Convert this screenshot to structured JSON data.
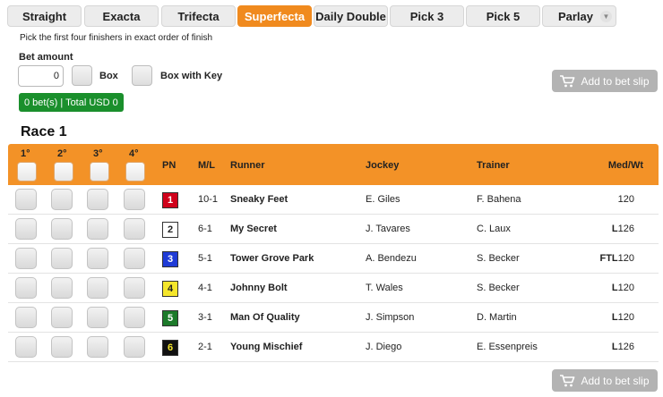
{
  "tabs": [
    {
      "label": "Straight",
      "active": false
    },
    {
      "label": "Exacta",
      "active": false
    },
    {
      "label": "Trifecta",
      "active": false
    },
    {
      "label": "Superfecta",
      "active": true
    },
    {
      "label": "Daily Double",
      "active": false
    },
    {
      "label": "Pick 3",
      "active": false
    },
    {
      "label": "Pick 5",
      "active": false
    },
    {
      "label": "Parlay",
      "active": false
    }
  ],
  "description": "Pick the first four finishers in exact order of finish",
  "bet": {
    "label": "Bet amount",
    "value": "0",
    "box_label": "Box",
    "box_with_key_label": "Box with Key"
  },
  "add_to_slip_label": "Add to bet slip",
  "total_badge": "0 bet(s) | Total USD 0",
  "race": {
    "title": "Race 1",
    "columns": {
      "pos1": "1°",
      "pos2": "2°",
      "pos3": "3°",
      "pos4": "4°",
      "pn": "PN",
      "ml": "M/L",
      "runner": "Runner",
      "jockey": "Jockey",
      "trainer": "Trainer",
      "medwt": "Med/Wt"
    },
    "entries": [
      {
        "pn": "1",
        "ml": "10-1",
        "runner": "Sneaky Feet",
        "jockey": "E. Giles",
        "trainer": "F. Bahena",
        "med": "",
        "wt": "120",
        "pn_bg": "#d0021b",
        "pn_fg": "#ffffff"
      },
      {
        "pn": "2",
        "ml": "6-1",
        "runner": "My Secret",
        "jockey": "J. Tavares",
        "trainer": "C. Laux",
        "med": "L",
        "wt": "126",
        "pn_bg": "#ffffff",
        "pn_fg": "#222222"
      },
      {
        "pn": "3",
        "ml": "5-1",
        "runner": "Tower Grove Park",
        "jockey": "A. Bendezu",
        "trainer": "S. Becker",
        "med": "FTL",
        "wt": "120",
        "pn_bg": "#1f3bd6",
        "pn_fg": "#ffffff"
      },
      {
        "pn": "4",
        "ml": "4-1",
        "runner": "Johnny Bolt",
        "jockey": "T. Wales",
        "trainer": "S. Becker",
        "med": "L",
        "wt": "120",
        "pn_bg": "#f5e62b",
        "pn_fg": "#222222"
      },
      {
        "pn": "5",
        "ml": "3-1",
        "runner": "Man Of Quality",
        "jockey": "J. Simpson",
        "trainer": "D. Martin",
        "med": "L",
        "wt": "120",
        "pn_bg": "#1c7a2a",
        "pn_fg": "#ffffff"
      },
      {
        "pn": "6",
        "ml": "2-1",
        "runner": "Young Mischief",
        "jockey": "J. Diego",
        "trainer": "E. Essenpreis",
        "med": "L",
        "wt": "126",
        "pn_bg": "#111111",
        "pn_fg": "#f5e62b"
      }
    ]
  },
  "icons": {
    "cart": "cart-icon",
    "chevron": "chevron-down-icon"
  },
  "colors": {
    "accent": "#f08a1e",
    "badge": "#1a8f2c",
    "disabled_button": "#b3b3b3"
  }
}
